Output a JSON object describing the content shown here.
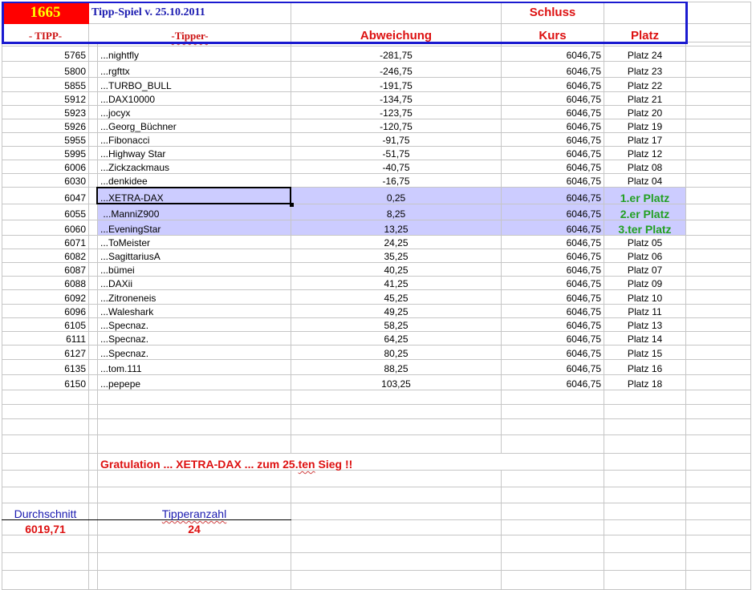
{
  "header": {
    "count": "1665",
    "title": "Tipp-Spiel v. 25.10.2011",
    "schluss": "Schluss",
    "col_tipp": "- TIPP-",
    "col_tipper": "-Tipper-",
    "col_abweichung": "Abweichung",
    "col_kurs": "Kurs",
    "col_platz": "Platz"
  },
  "rows": [
    {
      "tipp": "5765",
      "tipper": "...nightfly",
      "abw": "-281,75",
      "kurs": "6046,75",
      "platz": "Platz 24"
    },
    {
      "tipp": "5800",
      "tipper": "...rgfttx",
      "abw": "-246,75",
      "kurs": "6046,75",
      "platz": "Platz 23"
    },
    {
      "tipp": "5855",
      "tipper": "...TURBO_BULL",
      "abw": "-191,75",
      "kurs": "6046,75",
      "platz": "Platz 22"
    },
    {
      "tipp": "5912",
      "tipper": "...DAX10000",
      "abw": "-134,75",
      "kurs": "6046,75",
      "platz": "Platz 21"
    },
    {
      "tipp": "5923",
      "tipper": "...jocyx",
      "abw": "-123,75",
      "kurs": "6046,75",
      "platz": "Platz 20"
    },
    {
      "tipp": "5926",
      "tipper": "...Georg_Büchner",
      "abw": "-120,75",
      "kurs": "6046,75",
      "platz": "Platz 19"
    },
    {
      "tipp": "5955",
      "tipper": "...Fibonacci",
      "abw": "-91,75",
      "kurs": "6046,75",
      "platz": "Platz 17"
    },
    {
      "tipp": "5995",
      "tipper": "...Highway Star",
      "abw": "-51,75",
      "kurs": "6046,75",
      "platz": "Platz 12"
    },
    {
      "tipp": "6006",
      "tipper": "...Zickzackmaus",
      "abw": "-40,75",
      "kurs": "6046,75",
      "platz": "Platz 08"
    },
    {
      "tipp": "6030",
      "tipper": "...denkidee",
      "abw": "-16,75",
      "kurs": "6046,75",
      "platz": "Platz 04"
    },
    {
      "tipp": "6047",
      "tipper": "...XETRA-DAX",
      "abw": "0,25",
      "kurs": "6046,75",
      "platz": "1.er Platz",
      "win": true
    },
    {
      "tipp": "6055",
      "tipper": " ...ManniZ900",
      "abw": "8,25",
      "kurs": "6046,75",
      "platz": "2.er Platz",
      "win": true
    },
    {
      "tipp": "6060",
      "tipper": "...EveningStar",
      "abw": "13,25",
      "kurs": "6046,75",
      "platz": "3.ter Platz",
      "win": true
    },
    {
      "tipp": "6071",
      "tipper": "...ToMeister",
      "abw": "24,25",
      "kurs": "6046,75",
      "platz": "Platz 05"
    },
    {
      "tipp": "6082",
      "tipper": "...SagittariusA",
      "abw": "35,25",
      "kurs": "6046,75",
      "platz": "Platz 06"
    },
    {
      "tipp": "6087",
      "tipper": "...bümei",
      "abw": "40,25",
      "kurs": "6046,75",
      "platz": "Platz 07"
    },
    {
      "tipp": "6088",
      "tipper": "...DAXii",
      "abw": "41,25",
      "kurs": "6046,75",
      "platz": "Platz 09"
    },
    {
      "tipp": "6092",
      "tipper": "...Zitroneneis",
      "abw": "45,25",
      "kurs": "6046,75",
      "platz": "Platz 10"
    },
    {
      "tipp": "6096",
      "tipper": "...Waleshark",
      "abw": "49,25",
      "kurs": "6046,75",
      "platz": "Platz 11"
    },
    {
      "tipp": "6105",
      "tipper": "...Specnaz.",
      "abw": "58,25",
      "kurs": "6046,75",
      "platz": "Platz 13"
    },
    {
      "tipp": "6111",
      "tipper": "...Specnaz.",
      "abw": "64,25",
      "kurs": "6046,75",
      "platz": "Platz 14"
    },
    {
      "tipp": "6127",
      "tipper": "...Specnaz.",
      "abw": "80,25",
      "kurs": "6046,75",
      "platz": "Platz 15"
    },
    {
      "tipp": "6135",
      "tipper": "...tom.111",
      "abw": "88,25",
      "kurs": "6046,75",
      "platz": "Platz 16"
    },
    {
      "tipp": "6150",
      "tipper": "...pepepe",
      "abw": "103,25",
      "kurs": "6046,75",
      "platz": "Platz 18"
    }
  ],
  "footer": {
    "gratulation_pre": "Gratulation ...  XETRA-DAX ...  zum  25.",
    "gratulation_ten": "ten",
    "gratulation_post": " Sieg !!",
    "avg_label": "Durchschnitt",
    "avg_value": "6019,71",
    "count_label": "Tipperanzahl",
    "count_value": "24"
  }
}
